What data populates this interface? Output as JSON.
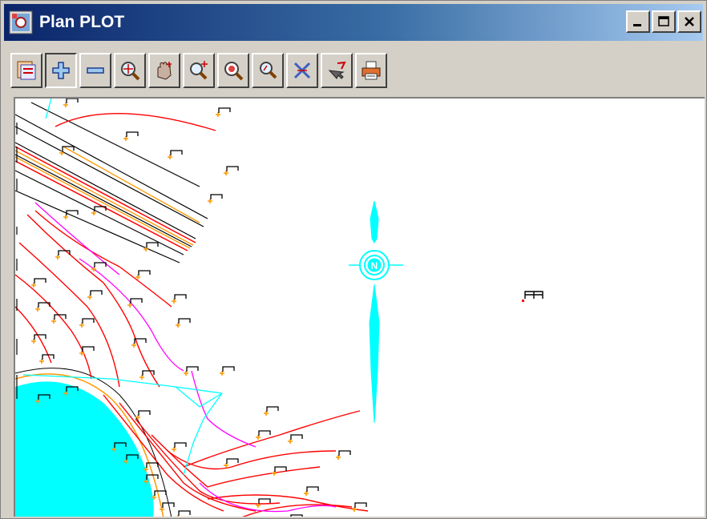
{
  "window": {
    "title": "Plan PLOT"
  },
  "caption_buttons": [
    {
      "name": "minimize-button",
      "icon": "minimize-icon"
    },
    {
      "name": "maximize-button",
      "icon": "maximize-icon"
    },
    {
      "name": "close-button",
      "icon": "close-icon"
    }
  ],
  "toolbar": {
    "buttons": [
      {
        "name": "plot-menu-button",
        "icon": "plot-menu-icon",
        "pressed": false
      },
      {
        "name": "add-button",
        "icon": "plus-icon",
        "pressed": true
      },
      {
        "name": "remove-button",
        "icon": "minus-icon",
        "pressed": false
      },
      {
        "name": "zoom-extents-button",
        "icon": "zoom-extents-icon",
        "pressed": false
      },
      {
        "name": "pan-button",
        "icon": "pan-hand-icon",
        "pressed": false
      },
      {
        "name": "zoom-in-button",
        "icon": "zoom-in-icon",
        "pressed": false
      },
      {
        "name": "zoom-window-button",
        "icon": "zoom-window-icon",
        "pressed": false
      },
      {
        "name": "zoom-out-button",
        "icon": "zoom-out-icon",
        "pressed": false
      },
      {
        "name": "cancel-button",
        "icon": "cancel-cross-icon",
        "pressed": false
      },
      {
        "name": "pick-button",
        "icon": "pick-arrow-icon",
        "pressed": false
      },
      {
        "name": "print-button",
        "icon": "printer-icon",
        "pressed": false
      }
    ]
  },
  "plot": {
    "north_label": "N",
    "colors": {
      "contour": "#ff0000",
      "road": "#000000",
      "spot": "#ff9900",
      "sea": "#00ffff",
      "boundary": "#ff00ff",
      "north": "#00ffff",
      "background": "#ffffff"
    }
  }
}
